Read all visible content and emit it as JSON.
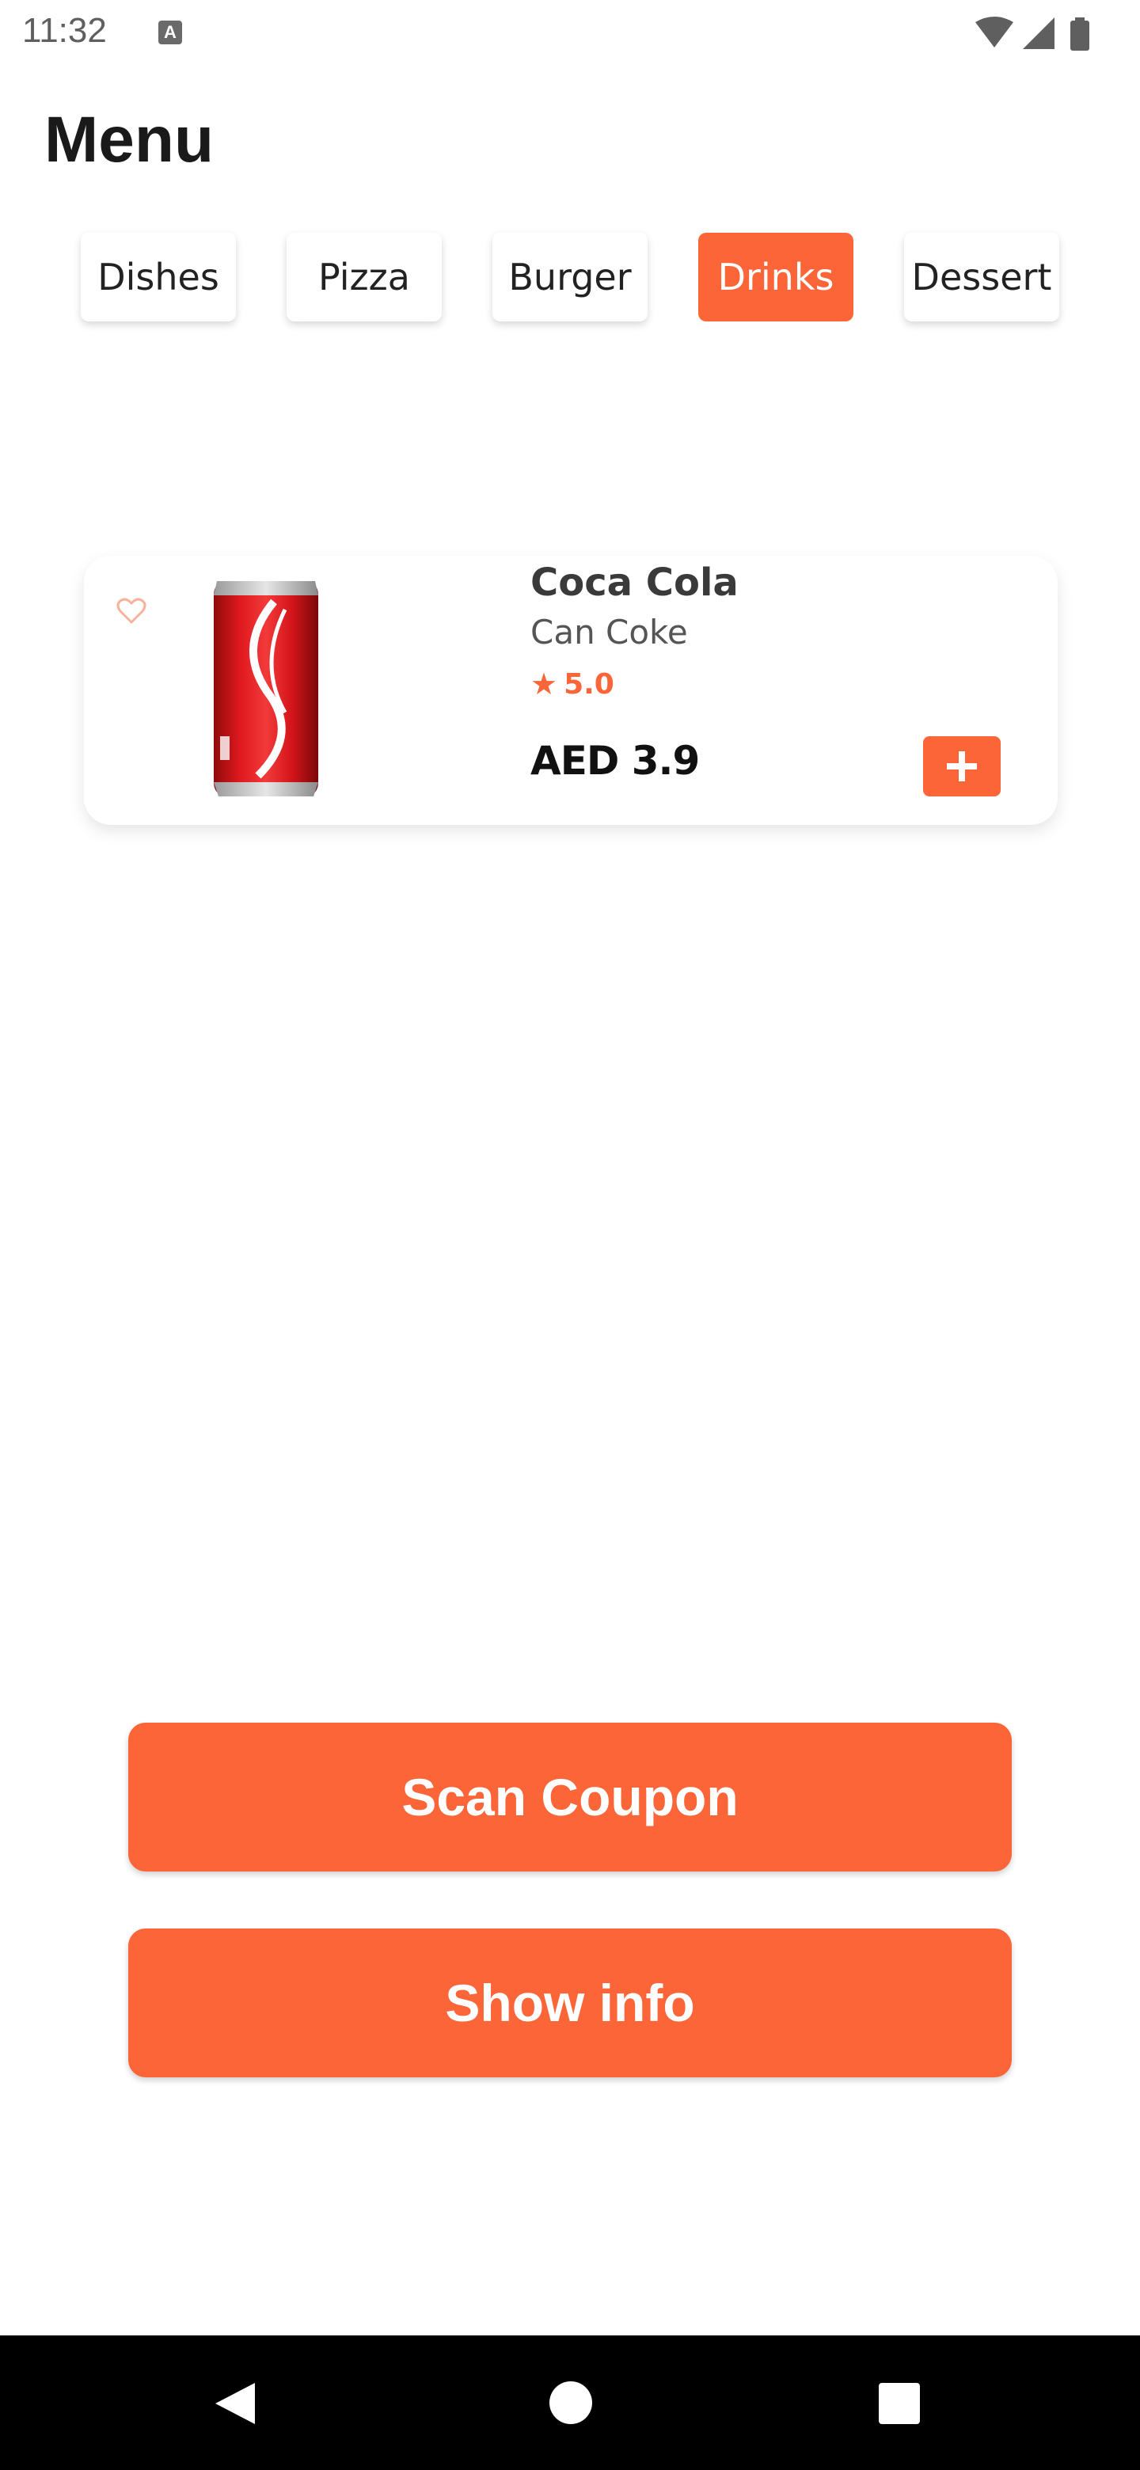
{
  "status_bar": {
    "time": "11:32",
    "notification_icon": "a-icon"
  },
  "page": {
    "title": "Menu"
  },
  "categories": [
    {
      "label": "Dishes",
      "active": false
    },
    {
      "label": "Pizza",
      "active": false
    },
    {
      "label": "Burger",
      "active": false
    },
    {
      "label": "Drinks",
      "active": true
    },
    {
      "label": "Dessert",
      "active": false
    }
  ],
  "product": {
    "name": "Coca Cola",
    "description": "Can Coke",
    "rating": "5.0",
    "price": "AED 3.9",
    "image_icon": "coca-cola-can-icon"
  },
  "actions": {
    "scan_coupon": "Scan Coupon",
    "show_info": "Show info"
  },
  "colors": {
    "accent": "#fb6538",
    "title": "#1a1a1a",
    "nav_bar": "#000000"
  }
}
